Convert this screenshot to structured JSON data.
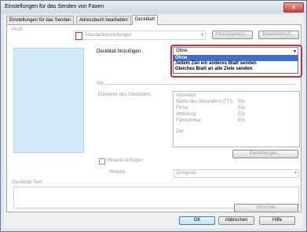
{
  "window": {
    "title": "Einstellungen für das Senden von Faxen",
    "close_glyph": "✕"
  },
  "tabs": [
    {
      "label": "Einstellungen für das Senden"
    },
    {
      "label": "Adressbuch bearbeiten"
    },
    {
      "label": "Deckblatt"
    }
  ],
  "profile": {
    "label": "Profil",
    "value": "Standardeinstellungen",
    "add_label": "Hinzufügen(1)...",
    "edit_label": "Bearbeiten(2)..."
  },
  "cover": {
    "add_label": "Deckblatt hinzufügen:",
    "selected": "Ohne",
    "options": [
      "Ohne",
      "Jedem Ziel ein anderes Blatt senden",
      "Gleiches Blatt an alle Ziele senden"
    ],
    "style_label": "Stil",
    "elements_label": "Elemente des Deckblatts:",
    "elements": [
      {
        "name": "Absender",
        "state": ""
      },
      {
        "name": "Name des Absenders (TTI):",
        "state": "Ein"
      },
      {
        "name": "Firma:",
        "state": "Ein"
      },
      {
        "name": "Abteilung:",
        "state": "Ein"
      },
      {
        "name": "Faxnummer:",
        "state": "Ein"
      },
      {
        "name": "Ziel",
        "state": ""
      }
    ],
    "settings_label": "Einstellungen..."
  },
  "notice": {
    "checkbox_label": "Hinweis einfügen",
    "label": "Hinweis",
    "value": "Dringend",
    "text_label": "Deckblatt-Text:"
  },
  "preview_label": "Vorschau",
  "footer": {
    "ok": "OK",
    "cancel": "Abbrechen",
    "help": "Hilfe"
  },
  "icons": {
    "profile": "profile-document-icon",
    "dropdown": "chevron-down-icon"
  }
}
